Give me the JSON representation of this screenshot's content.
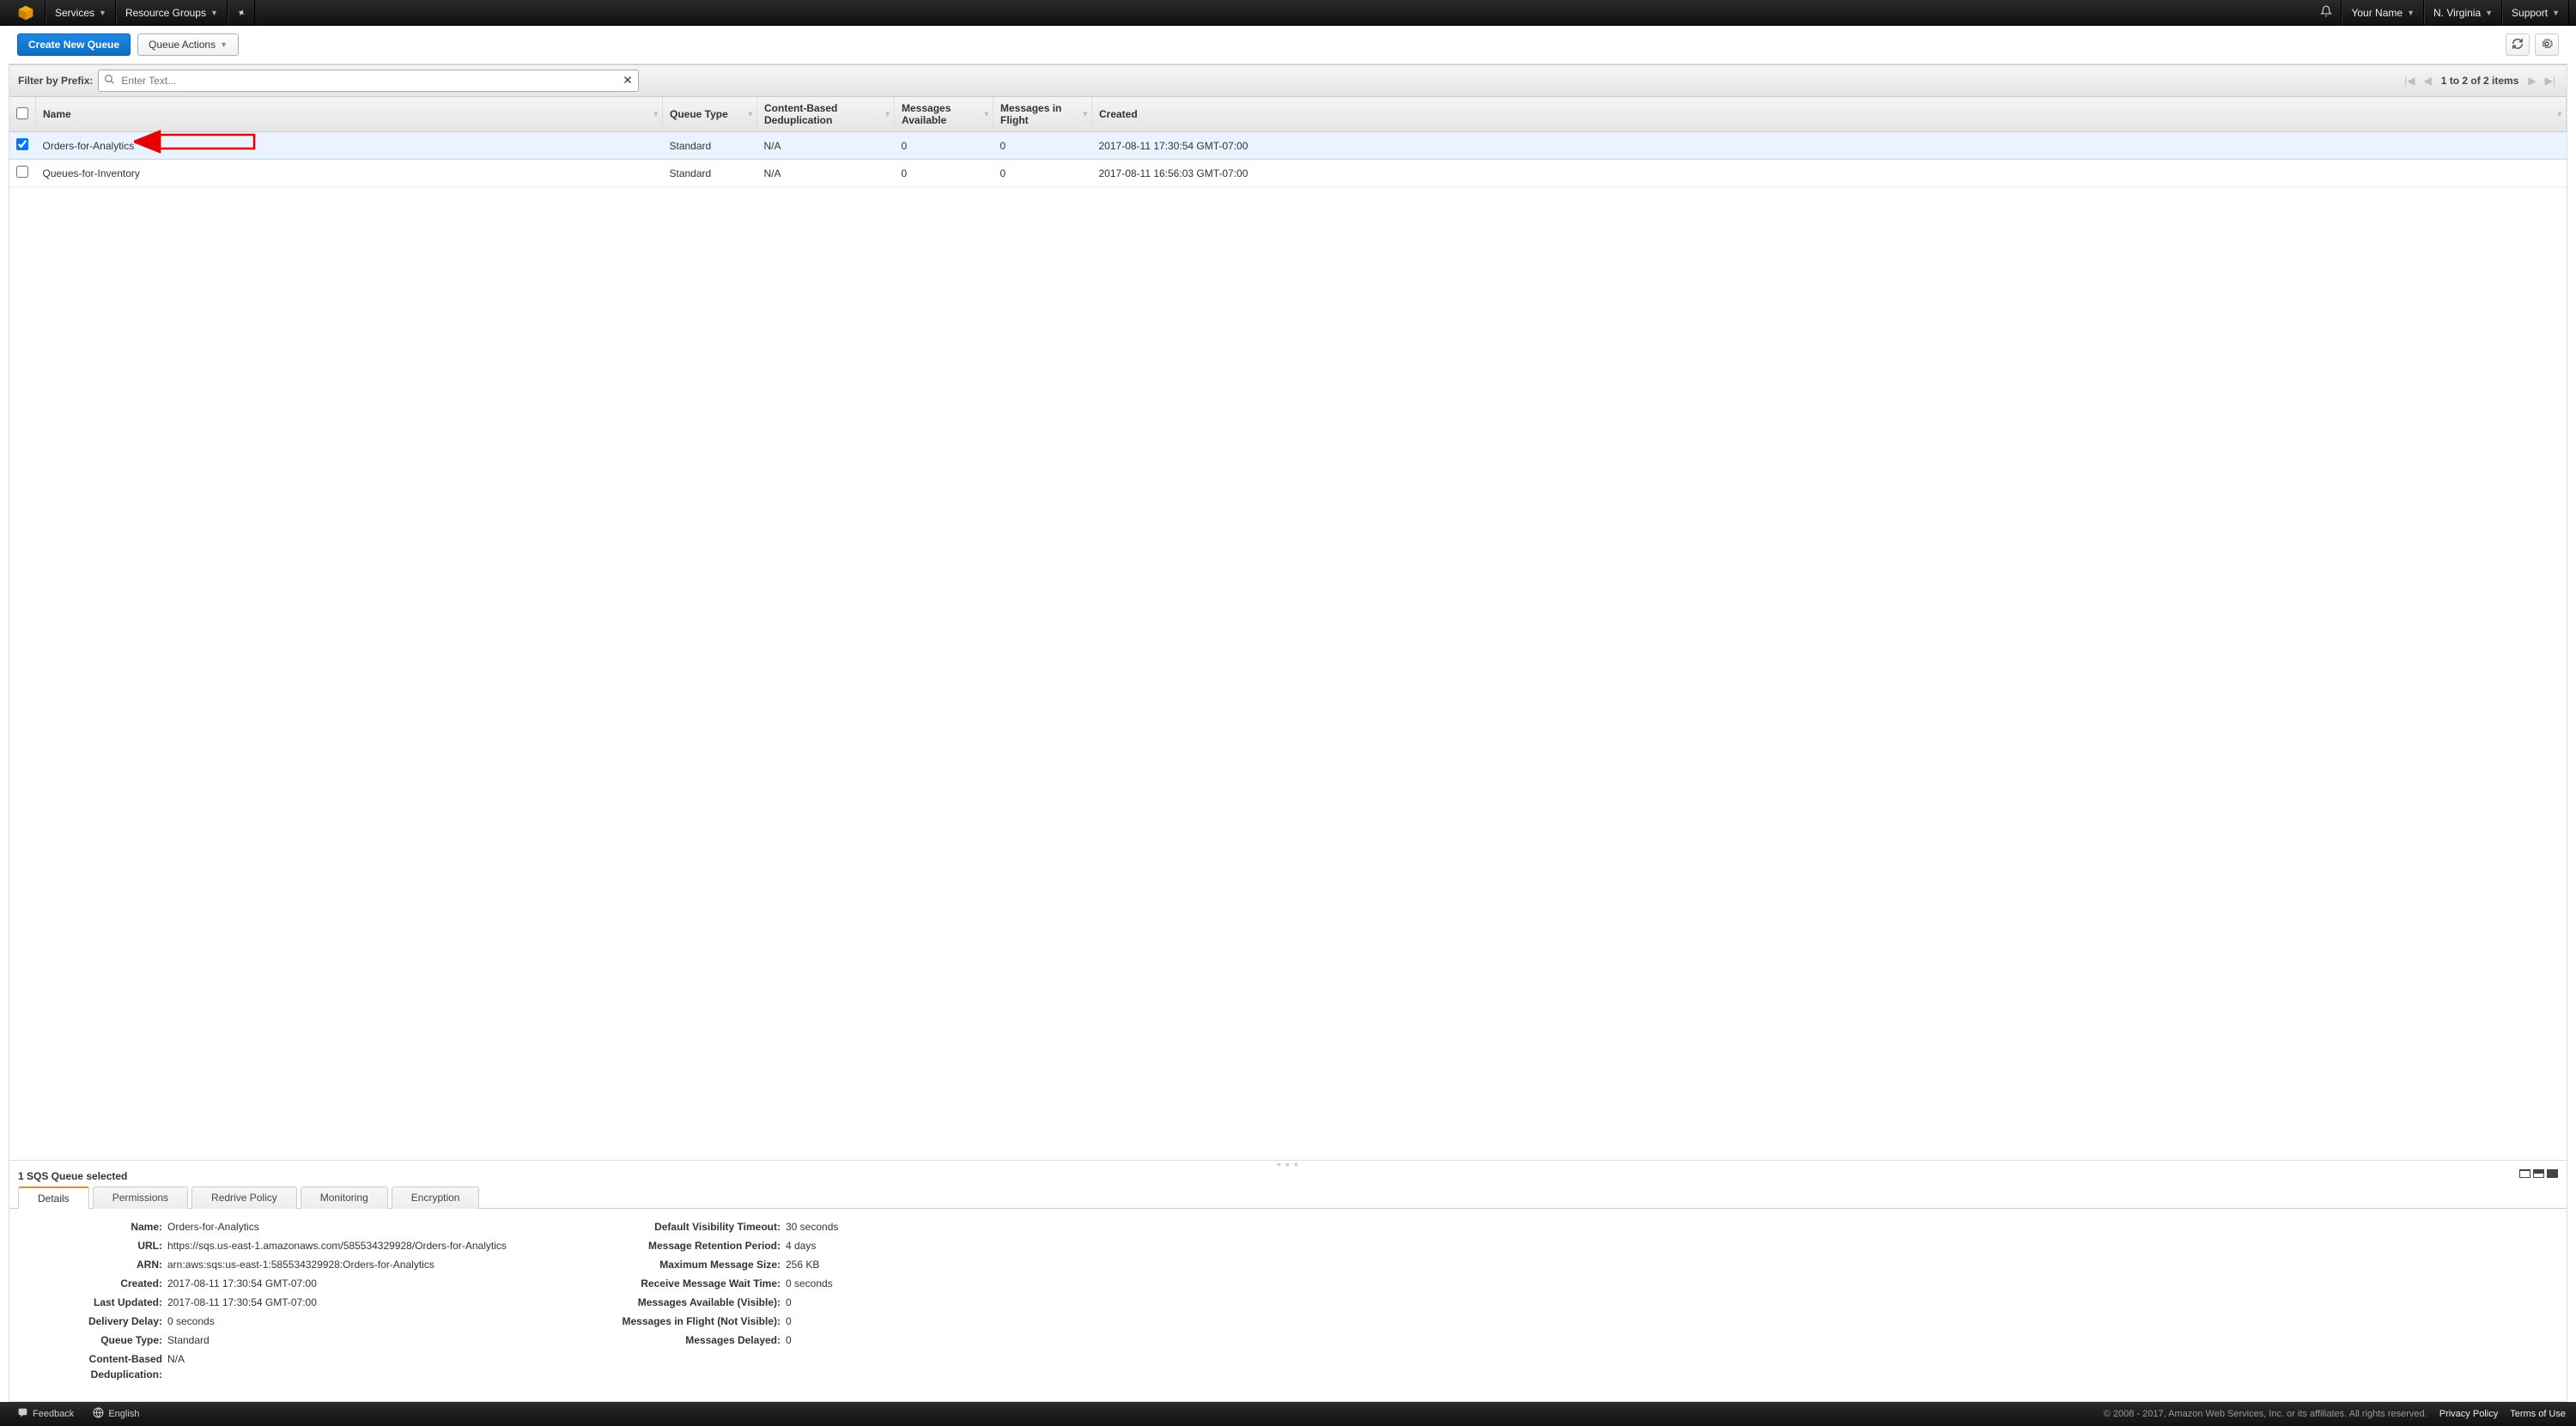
{
  "nav": {
    "services": "Services",
    "resource_groups": "Resource Groups",
    "your_name": "Your Name",
    "region": "N. Virginia",
    "support": "Support"
  },
  "toolbar": {
    "create_queue": "Create New Queue",
    "queue_actions": "Queue Actions"
  },
  "filter": {
    "label": "Filter by Prefix:",
    "placeholder": "Enter Text...",
    "pager_text": "1 to 2 of 2 items"
  },
  "table": {
    "headers": {
      "name": "Name",
      "queue_type": "Queue Type",
      "cbd": "Content-Based Deduplication",
      "msgs_avail": "Messages Available",
      "msgs_flight": "Messages in Flight",
      "created": "Created"
    },
    "rows": [
      {
        "selected": true,
        "name": "Orders-for-Analytics",
        "type": "Standard",
        "cbd": "N/A",
        "avail": "0",
        "flight": "0",
        "created": "2017-08-11 17:30:54 GMT-07:00"
      },
      {
        "selected": false,
        "name": "Queues-for-Inventory",
        "type": "Standard",
        "cbd": "N/A",
        "avail": "0",
        "flight": "0",
        "created": "2017-08-11 16:56:03 GMT-07:00"
      }
    ]
  },
  "panel": {
    "title": "1 SQS Queue selected",
    "tabs": {
      "details": "Details",
      "permissions": "Permissions",
      "redrive": "Redrive Policy",
      "monitoring": "Monitoring",
      "encryption": "Encryption"
    },
    "details": {
      "left": {
        "name": {
          "label": "Name:",
          "value": "Orders-for-Analytics"
        },
        "url": {
          "label": "URL:",
          "value": "https://sqs.us-east-1.amazonaws.com/585534329928/Orders-for-Analytics"
        },
        "arn": {
          "label": "ARN:",
          "value": "arn:aws:sqs:us-east-1:585534329928:Orders-for-Analytics"
        },
        "created": {
          "label": "Created:",
          "value": "2017-08-11 17:30:54 GMT-07:00"
        },
        "updated": {
          "label": "Last Updated:",
          "value": "2017-08-11 17:30:54 GMT-07:00"
        },
        "delay": {
          "label": "Delivery Delay:",
          "value": "0 seconds"
        },
        "qtype": {
          "label": "Queue Type:",
          "value": "Standard"
        },
        "cbd": {
          "label": "Content-Based Deduplication:",
          "value": "N/A"
        }
      },
      "right": {
        "vis_timeout": {
          "label": "Default Visibility Timeout:",
          "value": "30 seconds"
        },
        "retention": {
          "label": "Message Retention Period:",
          "value": "4 days"
        },
        "max_size": {
          "label": "Maximum Message Size:",
          "value": "256 KB"
        },
        "wait": {
          "label": "Receive Message Wait Time:",
          "value": "0 seconds"
        },
        "avail": {
          "label": "Messages Available (Visible):",
          "value": "0"
        },
        "flight": {
          "label": "Messages in Flight (Not Visible):",
          "value": "0"
        },
        "delayed": {
          "label": "Messages Delayed:",
          "value": "0"
        }
      }
    }
  },
  "footer": {
    "feedback": "Feedback",
    "english": "English",
    "copyright": "© 2008 - 2017, Amazon Web Services, Inc. or its affiliates. All rights reserved.",
    "privacy": "Privacy Policy",
    "terms": "Terms of Use"
  }
}
